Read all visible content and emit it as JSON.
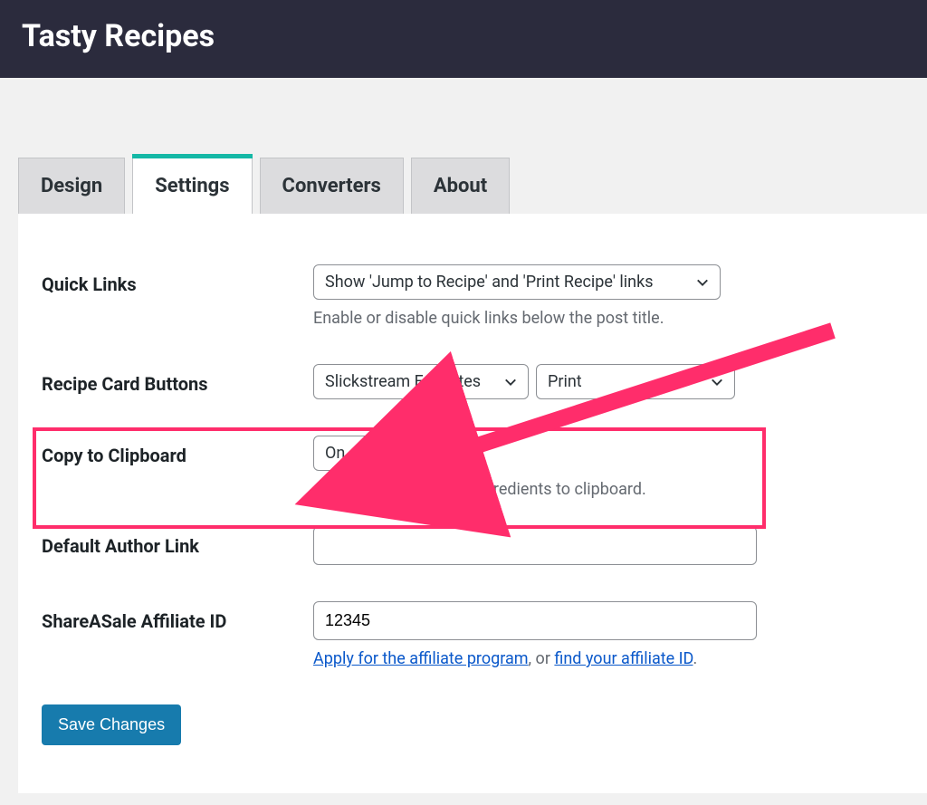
{
  "header": {
    "title": "Tasty Recipes"
  },
  "tabs": {
    "items": [
      {
        "label": "Design",
        "active": false
      },
      {
        "label": "Settings",
        "active": true
      },
      {
        "label": "Converters",
        "active": false
      },
      {
        "label": "About",
        "active": false
      }
    ]
  },
  "fields": {
    "quick_links": {
      "label": "Quick Links",
      "value": "Show 'Jump to Recipe' and 'Print Recipe' links",
      "help": "Enable or disable quick links below the post title."
    },
    "recipe_card_buttons": {
      "label": "Recipe Card Buttons",
      "value1": "Slickstream Favorites",
      "value2": "Print"
    },
    "copy_clipboard": {
      "label": "Copy to Clipboard",
      "value": "On",
      "help": "Allow visitors to copy ingredients to clipboard."
    },
    "default_author_link": {
      "label": "Default Author Link",
      "value": ""
    },
    "shareasale": {
      "label": "ShareASale Affiliate ID",
      "value": "12345",
      "help_link1": "Apply for the affiliate program",
      "help_mid": ", or ",
      "help_link2": "find your affiliate ID",
      "help_end": "."
    }
  },
  "actions": {
    "save": "Save Changes"
  },
  "colors": {
    "accent": "#14b8a6",
    "primary_btn": "#177bad",
    "highlight": "#ff2d6b",
    "link": "#0a58ca"
  }
}
